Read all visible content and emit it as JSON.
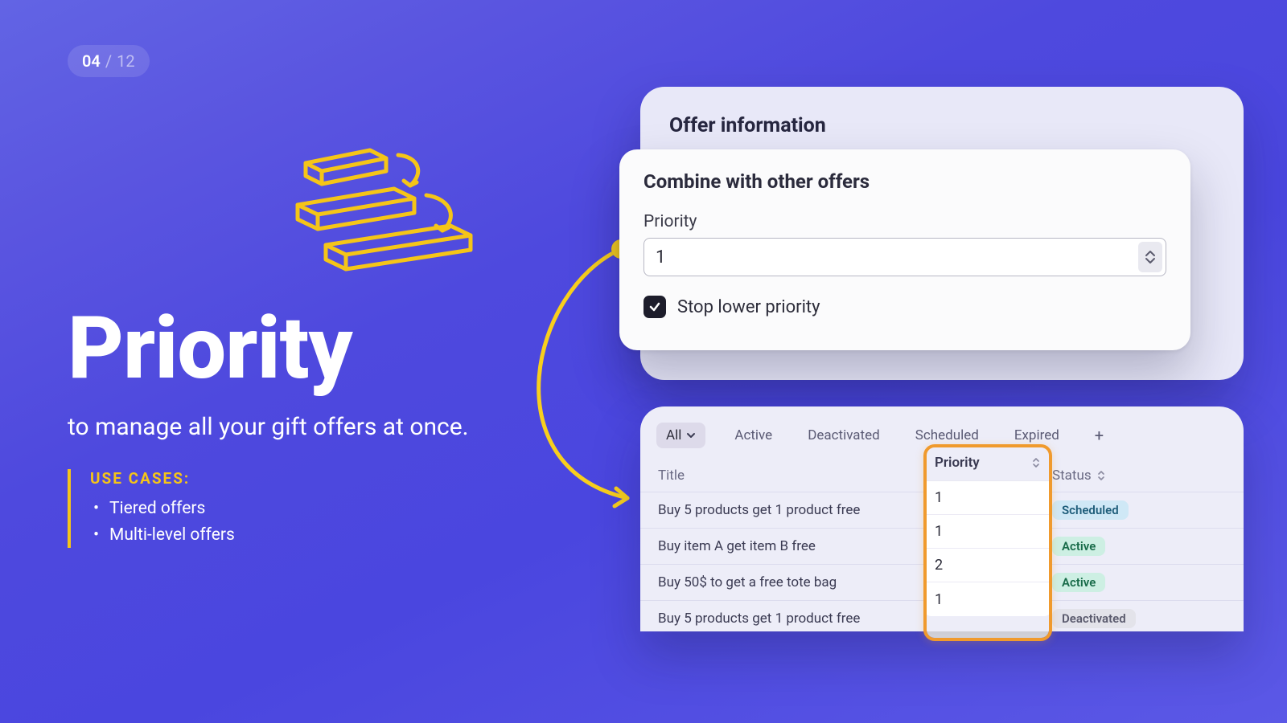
{
  "pagination": {
    "current": "04",
    "separator": "/",
    "total": "12"
  },
  "hero": {
    "title": "Priority",
    "subtitle": "to manage all your gift offers at once."
  },
  "usecases": {
    "heading": "USE CASES:",
    "items": [
      "Tiered offers",
      "Multi-level offers"
    ]
  },
  "offer_panel": {
    "header_title": "Offer information",
    "section_title": "Combine with other offers",
    "priority_label": "Priority",
    "priority_value": "1",
    "stop_lower_label": "Stop lower priority",
    "stop_lower_checked": true
  },
  "list": {
    "tabs": {
      "all": "All",
      "active": "Active",
      "deactivated": "Deactivated",
      "scheduled": "Scheduled",
      "expired": "Expired"
    },
    "columns": {
      "title": "Title",
      "priority": "Priority",
      "status": "Status"
    },
    "rows": [
      {
        "title": "Buy 5 products get 1 product free",
        "priority": "1",
        "status": "Scheduled",
        "status_kind": "scheduled"
      },
      {
        "title": "Buy item A get item B free",
        "priority": "1",
        "status": "Active",
        "status_kind": "active"
      },
      {
        "title": "Buy 50$ to get a free tote bag",
        "priority": "2",
        "status": "Active",
        "status_kind": "active"
      },
      {
        "title": "Buy 5 products get 1 product free",
        "priority": "1",
        "status": "Deactivated",
        "status_kind": "deactivated"
      }
    ]
  },
  "colors": {
    "accent_yellow": "#f5c518",
    "highlight_orange": "#f09a2d"
  }
}
